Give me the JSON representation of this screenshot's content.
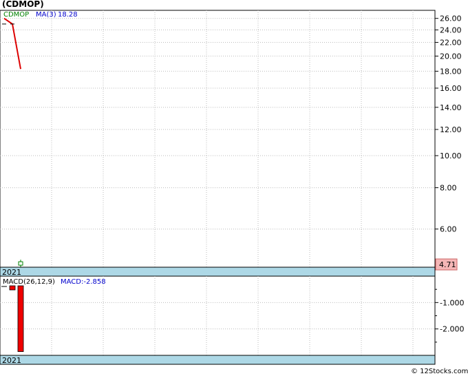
{
  "header": {
    "title": "(CDMOP)"
  },
  "chart_data": [
    {
      "type": "line",
      "ticker": "CDMOP",
      "indicator_label": "MA(3)",
      "indicator_value": "18.28",
      "scale": "log",
      "y_ticks": [
        "26.00",
        "24.00",
        "22.00",
        "20.00",
        "18.00",
        "16.00",
        "14.00",
        "12.00",
        "10.00",
        "8.00",
        "6.00"
      ],
      "y_tick_values": [
        26,
        24,
        22,
        20,
        18,
        16,
        14,
        12,
        10,
        8,
        6
      ],
      "ylim": [
        4.6,
        27.5
      ],
      "last_price_label": "4.71",
      "x_label": "2021",
      "ma_series": {
        "name": "MA(3)",
        "color": "#dd0000",
        "values": [
          26.0,
          25.0,
          18.28
        ]
      },
      "price_series": {
        "color": "#008000",
        "values": [
          25.0,
          25.0,
          4.71
        ]
      },
      "grid": true
    },
    {
      "type": "bar",
      "indicator_label": "MACD(26,12,9)",
      "value_label": "MACD:-2.858",
      "y_ticks": [
        "-1.000",
        "-2.000"
      ],
      "y_tick_values": [
        -1.0,
        -2.0
      ],
      "ylim": [
        -3.0,
        0.0
      ],
      "x_label": "2021",
      "colors": {
        "bar": "#ee0000",
        "signal": "#000000"
      },
      "values": [
        -0.06,
        -0.2,
        -2.858
      ],
      "signal": [
        -0.04,
        -0.1,
        -0.5
      ]
    }
  ],
  "footer": {
    "watermark": "© 12Stocks.com"
  },
  "colors": {
    "axis_band": "#add8e6",
    "price_badge_bg": "#f4b6b6",
    "border": "#000000",
    "grid": "#bbbbbb"
  }
}
